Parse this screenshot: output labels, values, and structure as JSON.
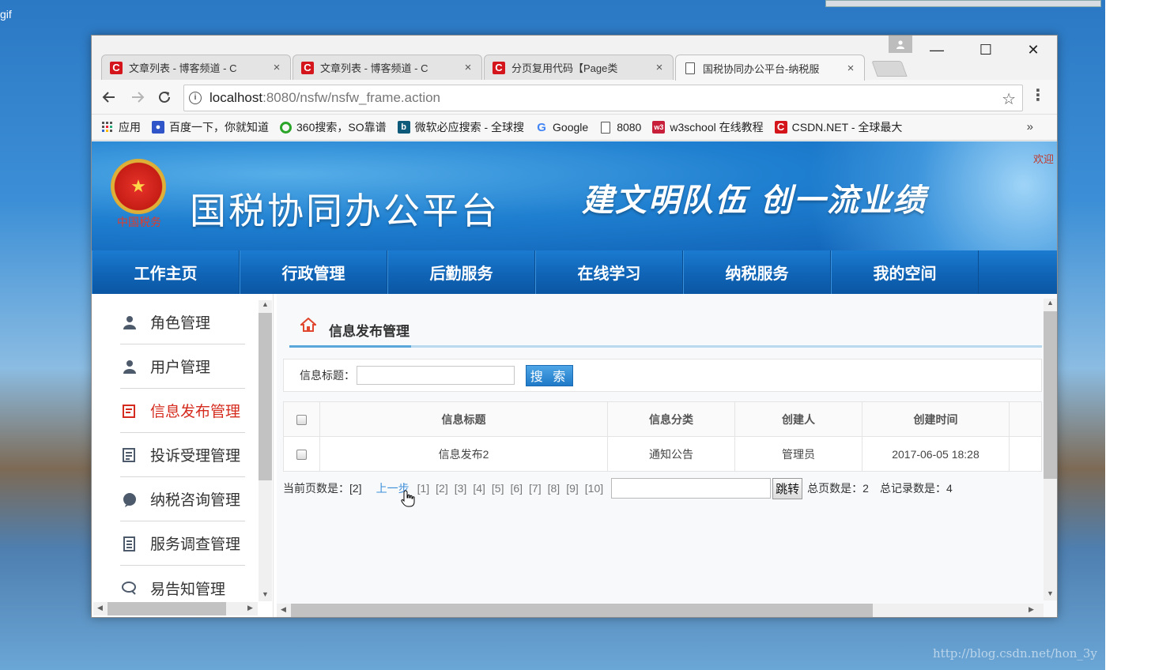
{
  "desktop": {
    "corner_text": "gif",
    "watermark": "http://blog.csdn.net/hon_3y"
  },
  "browser": {
    "tabs": [
      {
        "title": "文章列表 - 博客频道 - C",
        "icon": "csdn-icon"
      },
      {
        "title": "文章列表 - 博客频道 - C",
        "icon": "csdn-icon"
      },
      {
        "title": "分页复用代码【Page类",
        "icon": "csdn-icon"
      },
      {
        "title": "国税协同办公平台-纳税服",
        "icon": "document-icon",
        "active": true
      }
    ],
    "close_glyph": "×",
    "window_controls": {
      "minimize": "—",
      "maximize": "☐",
      "close": "✕"
    },
    "address": {
      "host": "localhost",
      "rest": ":8080/nsfw/nsfw_frame.action"
    },
    "bookmarks": [
      {
        "label": "应用",
        "icon": "apps-grid-icon"
      },
      {
        "label": "百度一下，你就知道",
        "icon": "baidu-paw-icon"
      },
      {
        "label": "360搜索，SO靠谱",
        "icon": "360-icon"
      },
      {
        "label": "微软必应搜索 - 全球搜",
        "icon": "bing-icon"
      },
      {
        "label": "Google",
        "icon": "google-icon"
      },
      {
        "label": "8080",
        "icon": "page-icon"
      },
      {
        "label": "w3school 在线教程",
        "icon": "w3school-icon"
      },
      {
        "label": "CSDN.NET - 全球最大",
        "icon": "csdn-icon"
      }
    ],
    "bookmarks_more": "»"
  },
  "site": {
    "emblem_caption": "中国税务",
    "title": "国税协同办公平台",
    "slogan": "建文明队伍  创一流业绩",
    "banner_edge_text": "欢迎",
    "nav": [
      "工作主页",
      "行政管理",
      "后勤服务",
      "在线学习",
      "纳税服务",
      "我的空间"
    ]
  },
  "sidebar": {
    "items": [
      {
        "label": "角色管理",
        "icon": "user-icon"
      },
      {
        "label": "用户管理",
        "icon": "user-icon"
      },
      {
        "label": "信息发布管理",
        "icon": "info-publish-icon",
        "active": true
      },
      {
        "label": "投诉受理管理",
        "icon": "complaint-icon"
      },
      {
        "label": "纳税咨询管理",
        "icon": "consult-icon"
      },
      {
        "label": "服务调查管理",
        "icon": "survey-icon"
      },
      {
        "label": "易告知管理",
        "icon": "notify-icon"
      }
    ]
  },
  "content": {
    "title": "信息发布管理",
    "search": {
      "label": "信息标题：",
      "value": "",
      "button": "搜 索"
    },
    "table": {
      "columns": [
        "信息标题",
        "信息分类",
        "创建人",
        "创建时间",
        ""
      ],
      "rows": [
        {
          "title": "信息发布2",
          "category": "通知公告",
          "creator": "管理员",
          "created": "2017-06-05 18:28"
        }
      ]
    },
    "pager": {
      "current_label": "当前页数是：[2]",
      "prev": "上一步",
      "pages": [
        "[1]",
        "[2]",
        "[3]",
        "[4]",
        "[5]",
        "[6]",
        "[7]",
        "[8]",
        "[9]",
        "[10]"
      ],
      "jump_button": "跳转",
      "total_pages": "总页数是：2",
      "total_records": "总记录数是：4"
    }
  }
}
